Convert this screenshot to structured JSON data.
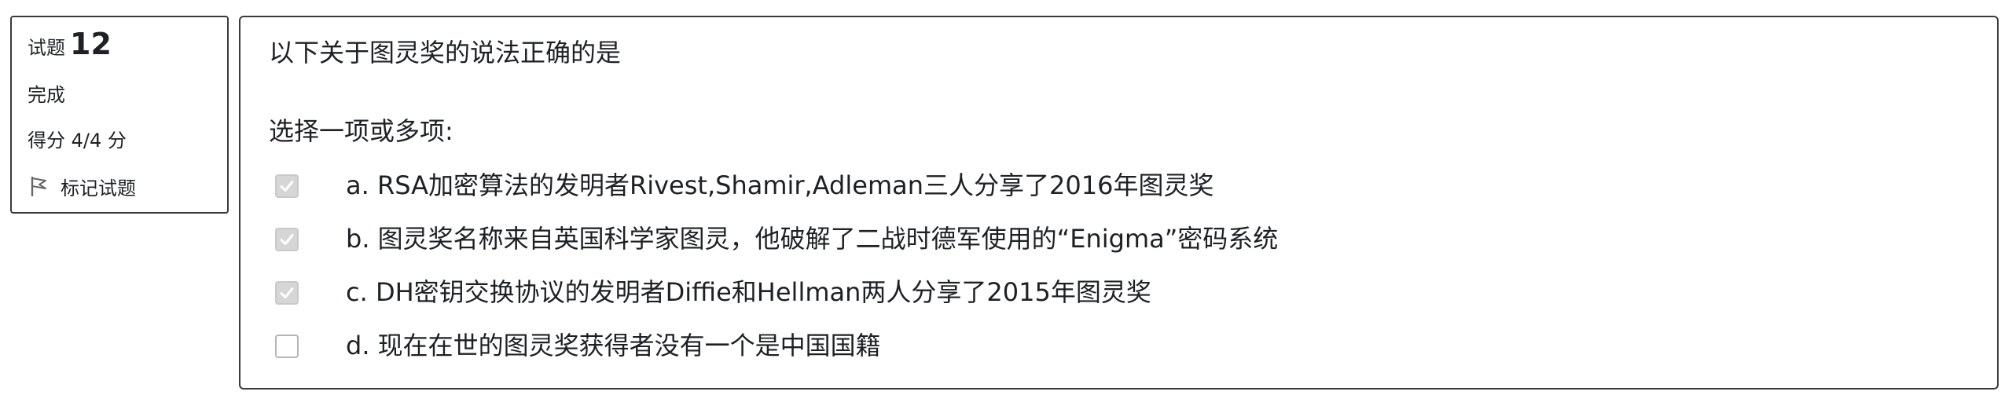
{
  "info": {
    "question_label": "试题",
    "question_number": "12",
    "state": "完成",
    "grade": "得分 4/4 分",
    "flag_label": "标记试题"
  },
  "question": {
    "text": "以下关于图灵奖的说法正确的是",
    "prompt": "选择一项或多项:",
    "answers": [
      {
        "label": "a. RSA加密算法的发明者Rivest,Shamir,Adleman三人分享了2016年图灵奖",
        "checked": true
      },
      {
        "label": "b. 图灵奖名称来自英国科学家图灵，他破解了二战时德军使用的“Enigma”密码系统",
        "checked": true
      },
      {
        "label": "c. DH密钥交换协议的发明者Diffie和Hellman两人分享了2015年图灵奖",
        "checked": true
      },
      {
        "label": "d. 现在在世的图灵奖获得者没有一个是中国国籍",
        "checked": false
      }
    ]
  },
  "icons": {
    "flag": "flag-icon",
    "check": "check-icon"
  },
  "colors": {
    "border": "#3a3a3a",
    "checked_fill": "#d6d6d6",
    "check_mark": "#ffffff",
    "text": "#1d2125"
  }
}
